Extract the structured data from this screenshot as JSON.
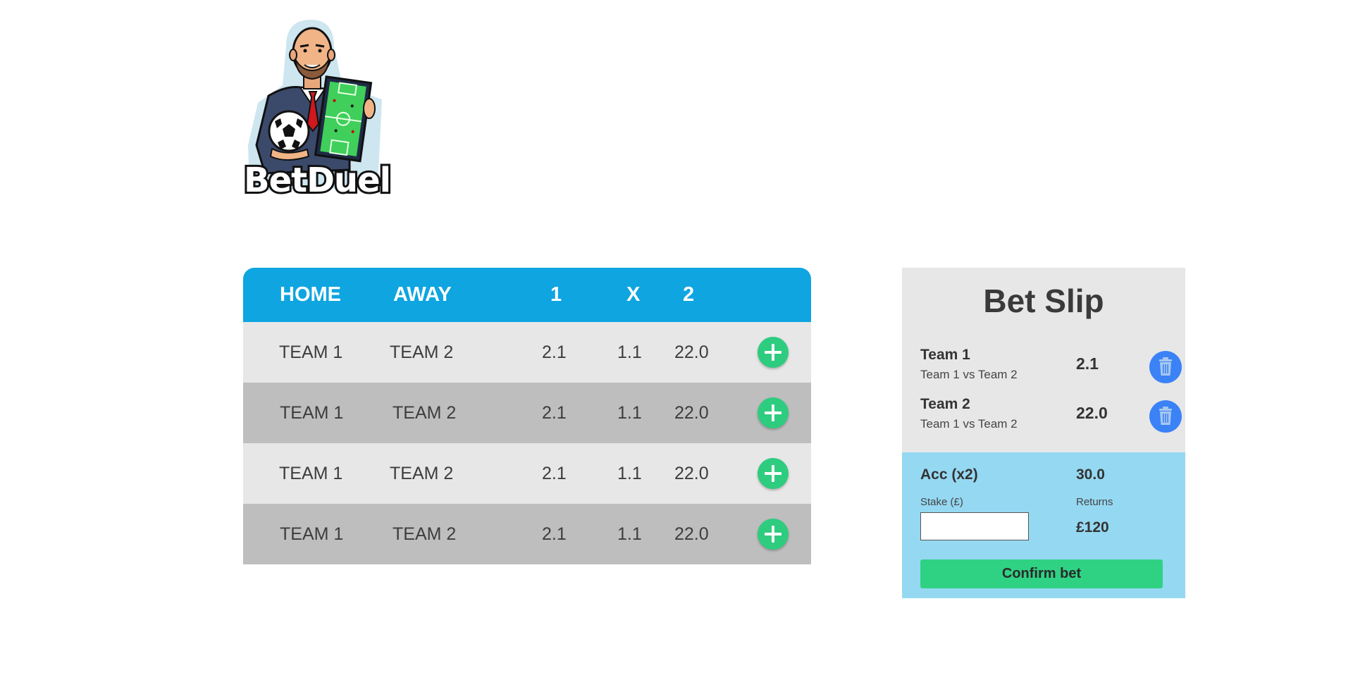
{
  "brand": {
    "logo_text": "BetDuel"
  },
  "matches": {
    "headers": {
      "home": "HOME",
      "away": "AWAY",
      "odd_1": "1",
      "odd_x": "X",
      "odd_2": "2"
    },
    "rows": [
      {
        "home": "TEAM 1",
        "away": "TEAM 2",
        "odd_1": "2.1",
        "odd_x": "1.1",
        "odd_2": "22.0"
      },
      {
        "home": "TEAM 1",
        "away": "TEAM 2",
        "odd_1": "2.1",
        "odd_x": "1.1",
        "odd_2": "22.0"
      },
      {
        "home": "TEAM 1",
        "away": "TEAM 2",
        "odd_1": "2.1",
        "odd_x": "1.1",
        "odd_2": "22.0"
      },
      {
        "home": "TEAM 1",
        "away": "TEAM 2",
        "odd_1": "2.1",
        "odd_x": "1.1",
        "odd_2": "22.0"
      }
    ],
    "add_icon": "plus-icon"
  },
  "bet_slip": {
    "title": "Bet Slip",
    "selections": [
      {
        "team": "Team 1",
        "match": "Team 1 vs Team 2",
        "odds": "2.1"
      },
      {
        "team": "Team 2",
        "match": "Team 1 vs Team 2",
        "odds": "22.0"
      }
    ],
    "delete_icon": "trash-icon",
    "acc_label": "Acc (x2)",
    "acc_odds": "30.0",
    "stake_label": "Stake (£)",
    "stake_value": "",
    "returns_label": "Returns",
    "returns_value": "£120",
    "confirm_label": "Confirm bet"
  },
  "colors": {
    "header_blue": "#0ea5e0",
    "add_green": "#2ecc7f",
    "delete_blue": "#3b82f6",
    "slip_blue": "#95d8f2",
    "confirm_green": "#2fd283"
  }
}
